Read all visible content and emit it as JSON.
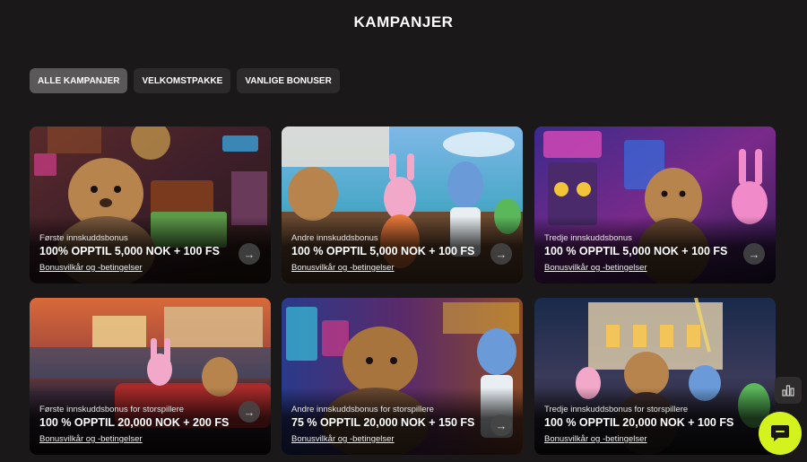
{
  "page": {
    "title": "KAMPANJER"
  },
  "filters": [
    {
      "label": "ALLE KAMPANJER",
      "active": true
    },
    {
      "label": "VELKOMSTPAKKE",
      "active": false
    },
    {
      "label": "VANLIGE BONUSER",
      "active": false
    }
  ],
  "promotions": [
    {
      "subtitle": "Første innskuddsbonus",
      "offer": "100% OPPTIL 5,000 NOK + 100 FS",
      "terms": "Bonusvilkår og -betingelser"
    },
    {
      "subtitle": "Andre innskuddsbonus",
      "offer": "100 % OPPTIL 5,000 NOK + 100 FS",
      "terms": "Bonusvilkår og -betingelser"
    },
    {
      "subtitle": "Tredje innskuddsbonus",
      "offer": "100 % OPPTIL 5,000 NOK + 100 FS",
      "terms": "Bonusvilkår og -betingelser"
    },
    {
      "subtitle": "Første innskuddsbonus for storspillere",
      "offer": "100 % OPPTIL 20,000 NOK + 200 FS",
      "terms": "Bonusvilkår og -betingelser"
    },
    {
      "subtitle": "Andre innskuddsbonus for storspillere",
      "offer": "75 % OPPTIL 20,000 NOK + 150 FS",
      "terms": "Bonusvilkår og -betingelser"
    },
    {
      "subtitle": "Tredje innskuddsbonus for storspillere",
      "offer": "100 % OPPTIL 20,000 NOK + 100 FS",
      "terms": "Bonusvilkår og -betingelser"
    }
  ],
  "icons": {
    "arrow": "arrow-right-icon",
    "chart": "bar-chart-icon",
    "chat": "chat-icon"
  },
  "colors": {
    "background": "#1a1818",
    "accent": "#d4f21e",
    "active_filter": "#5a5858"
  }
}
